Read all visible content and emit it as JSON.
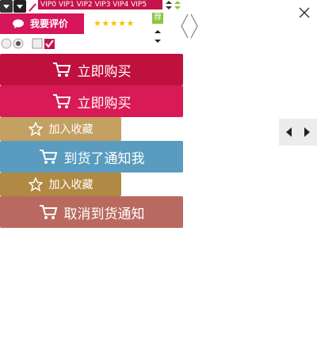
{
  "vip_levels": "VIP0 VIP1 VIP2 VIP3 VIP4 VIP5",
  "evaluate_label": "我要评价",
  "stars": "★★★★★",
  "green_badge": "荐",
  "buttons": {
    "buy_now_1": "立即购买",
    "buy_now_2": "立即购买",
    "add_favorite_1": "加入收藏",
    "notify_arrival": "到货了通知我",
    "add_favorite_2": "加入收藏",
    "cancel_notify": "取消到货通知"
  },
  "colors": {
    "buy_now_1": "#c0103e",
    "buy_now_2": "#d81b57",
    "add_favorite_1": "#c4a062",
    "notify_arrival": "#5a9cbf",
    "add_favorite_2": "#b08a44",
    "cancel_notify": "#b96a60",
    "vip_strip": "#c4144b",
    "evaluate": "#d6155a",
    "stars": "#f5c300",
    "badge": "#8cc43c"
  }
}
